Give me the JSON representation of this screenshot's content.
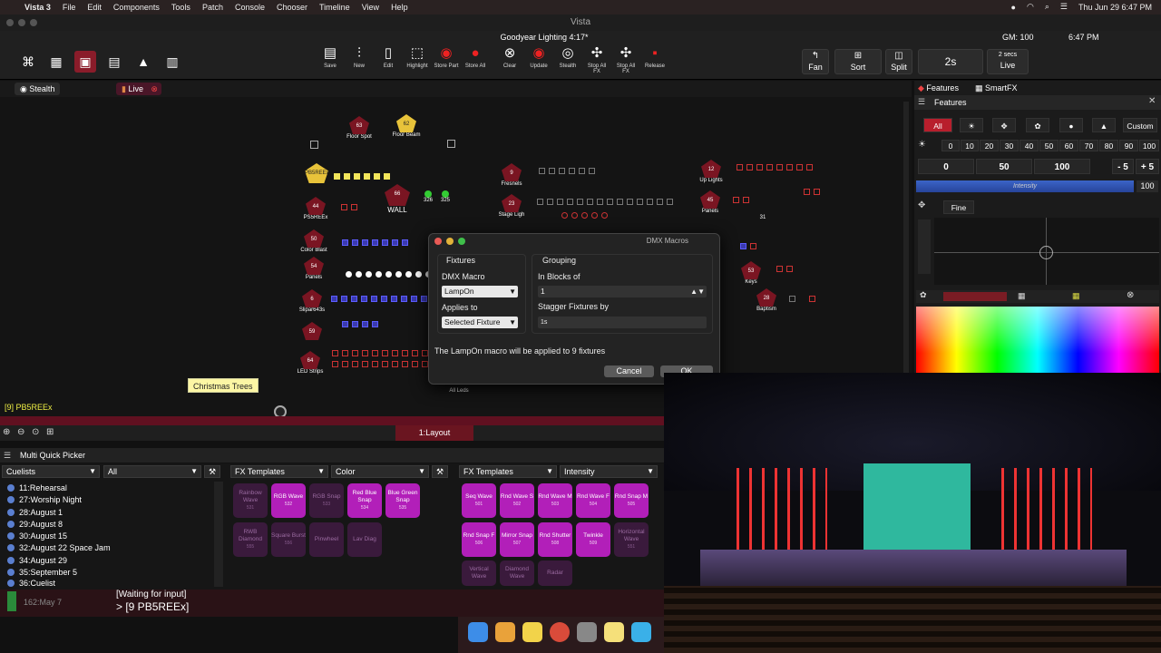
{
  "menubar": {
    "app": "Vista 3",
    "items": [
      "File",
      "Edit",
      "Components",
      "Tools",
      "Patch",
      "Console",
      "Chooser",
      "Timeline",
      "View",
      "Help"
    ],
    "datetime": "Thu Jun 29  6:47 PM"
  },
  "window": {
    "title": "Vista",
    "show_name": "Goodyear Lighting 4:17*",
    "gm": "GM: 100",
    "clock": "6:47 PM"
  },
  "toolbar": {
    "buttons": [
      "Save",
      "New",
      "Edit",
      "Highlight",
      "Store Part",
      "Store All",
      "Clear",
      "Update",
      "Stealth",
      "Stop All FX",
      "Stop All FX",
      "Release"
    ],
    "fan": "Fan",
    "sort": "Sort",
    "split": "Split",
    "time": "2s",
    "secs": "2 secs",
    "live": "Live"
  },
  "stage_header": {
    "stealth": "Stealth",
    "live": "Live"
  },
  "fixtures": {
    "floor_spot_num": "63",
    "floor_spot": "Floor Spot",
    "floor_beam_num": "62",
    "floor_beam": "Floor Beam",
    "pb5reex": "PB5REEx",
    "wall_num": "66",
    "wall": "WALL",
    "p326": "326",
    "p325": "325",
    "p44": "44",
    "ps5rex": "PS5REEx",
    "p50": "50",
    "colorblast": "Color Blast",
    "p54": "54",
    "panels": "Panels",
    "p6": "6",
    "slipar": "Slipar643s",
    "p59": "59",
    "p64": "64",
    "ledstrips": "LED Strips",
    "p9": "9",
    "fresnels": "Fresnels",
    "p23": "23",
    "stage_lights": "Stage Ligh",
    "p12": "12",
    "uplights": "Up Lights",
    "p45": "45",
    "panels2": "Panels",
    "p31": "31",
    "p53": "53",
    "keys": "Keys",
    "p28": "28",
    "baptism": "Baptism",
    "all_leds": "All Leds",
    "christmas": "Christmas Trees",
    "selected": "[9] PB5REEx"
  },
  "dialog": {
    "title": "DMX Macros",
    "fixtures_hdr": "Fixtures",
    "grouping_hdr": "Grouping",
    "dmx_macro_lbl": "DMX Macro",
    "dmx_macro_val": "LampOn",
    "applies_lbl": "Applies to",
    "applies_val": "Selected Fixture",
    "blocks_lbl": "In Blocks of",
    "blocks_val": "1",
    "stagger_lbl": "Stagger Fixtures by",
    "stagger_val": "1s",
    "message": "The LampOn macro will be applied to 9 fixtures",
    "cancel": "Cancel",
    "ok": "OK"
  },
  "features": {
    "tab1": "Features",
    "tab2": "SmartFX",
    "header": "Features",
    "all": "All",
    "custom": "Custom",
    "levels": [
      "0",
      "10",
      "20",
      "30",
      "40",
      "50",
      "60",
      "70",
      "80",
      "90",
      "100"
    ],
    "big": [
      "0",
      "50",
      "100"
    ],
    "minus5": "- 5",
    "plus5": "+ 5",
    "intensity": "Intensity",
    "intensity_val": "100",
    "fine": "Fine"
  },
  "layout_tab": "1:Layout",
  "mqp": {
    "title": "Multi Quick Picker",
    "cuelists": "Cuelists",
    "all": "All",
    "fx1": "FX Templates",
    "color": "Color",
    "fx2": "FX Templates",
    "intensity": "Intensity"
  },
  "cues": [
    "11:Rehearsal",
    "27:Worship Night",
    "28:August 1",
    "29:August 8",
    "30:August 15",
    "32:August 22 Space Jam",
    "34:August 29",
    "35:September 5",
    "36:Cuelist"
  ],
  "color_fx": [
    {
      "l": "Rainbow Wave",
      "n": "531"
    },
    {
      "l": "RGB Wave",
      "n": "532"
    },
    {
      "l": "RGB Snap",
      "n": "533"
    },
    {
      "l": "Red Blue Snap",
      "n": "534"
    },
    {
      "l": "Blue Green Snap",
      "n": "535"
    },
    {
      "l": "RWB Diamond",
      "n": "555"
    },
    {
      "l": "Square Burst",
      "n": "556"
    },
    {
      "l": "Pinwheel",
      "n": ""
    },
    {
      "l": "Lav Diag",
      "n": ""
    }
  ],
  "int_fx": [
    {
      "l": "Seq Wave",
      "n": "501"
    },
    {
      "l": "Rnd Wave S",
      "n": "502"
    },
    {
      "l": "Rnd Wave M",
      "n": "503"
    },
    {
      "l": "Rnd Wave F",
      "n": "504"
    },
    {
      "l": "Rnd Snap M",
      "n": "505"
    },
    {
      "l": "Rnd Snap F",
      "n": "506"
    },
    {
      "l": "Mirror Snap",
      "n": "507"
    },
    {
      "l": "Rnd Shutter",
      "n": "508"
    },
    {
      "l": "Twinkle",
      "n": "509"
    },
    {
      "l": "Horizontal Wave",
      "n": "551"
    },
    {
      "l": "Vertical Wave",
      "n": ""
    },
    {
      "l": "Diamond Wave",
      "n": ""
    },
    {
      "l": "Radar",
      "n": ""
    }
  ],
  "cmd": {
    "status": "[Waiting for input]",
    "prompt": "> [9 PB5REEx]",
    "cue_time": "162:May 7"
  }
}
